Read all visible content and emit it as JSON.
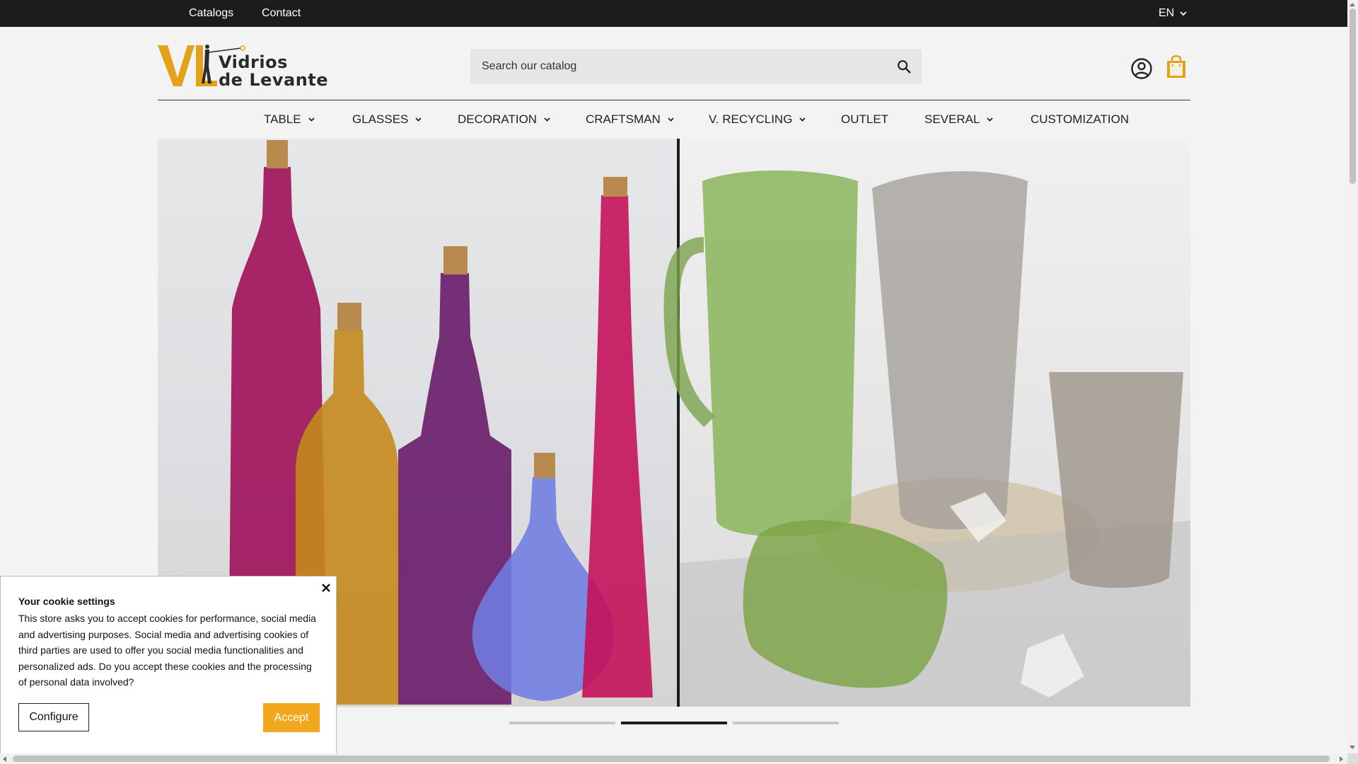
{
  "topbar": {
    "links": [
      "Catalogs",
      "Contact"
    ],
    "language": "EN"
  },
  "logo": {
    "line1": "Vidrios",
    "line2": "de Levante",
    "monogram": "VL",
    "accent_color": "#e3a21a"
  },
  "search": {
    "placeholder": "Search our catalog"
  },
  "icons": {
    "search": "search-icon",
    "account": "user-circle-icon",
    "cart": "shopping-bag-icon",
    "cart_color": "#e3a21a"
  },
  "nav": {
    "items": [
      {
        "label": "TABLE",
        "dropdown": true
      },
      {
        "label": "GLASSES",
        "dropdown": true
      },
      {
        "label": "DECORATION",
        "dropdown": true
      },
      {
        "label": "CRAFTSMAN",
        "dropdown": true
      },
      {
        "label": "V. RECYCLING",
        "dropdown": true
      },
      {
        "label": "OUTLET",
        "dropdown": false
      },
      {
        "label": "SEVERAL",
        "dropdown": true
      },
      {
        "label": "CUSTOMIZATION",
        "dropdown": false
      }
    ]
  },
  "slider": {
    "slide_count": 3,
    "active_index": 1
  },
  "cookie": {
    "title": "Your cookie settings",
    "body": "This store asks you to accept cookies for performance, social media and advertising purposes. Social media and advertising cookies of third parties are used to offer you social media functionalities and personalized ads. Do you accept these cookies and the processing of personal data involved?",
    "configure_label": "Configure",
    "accept_label": "Accept",
    "accept_color": "#f2a81e"
  }
}
